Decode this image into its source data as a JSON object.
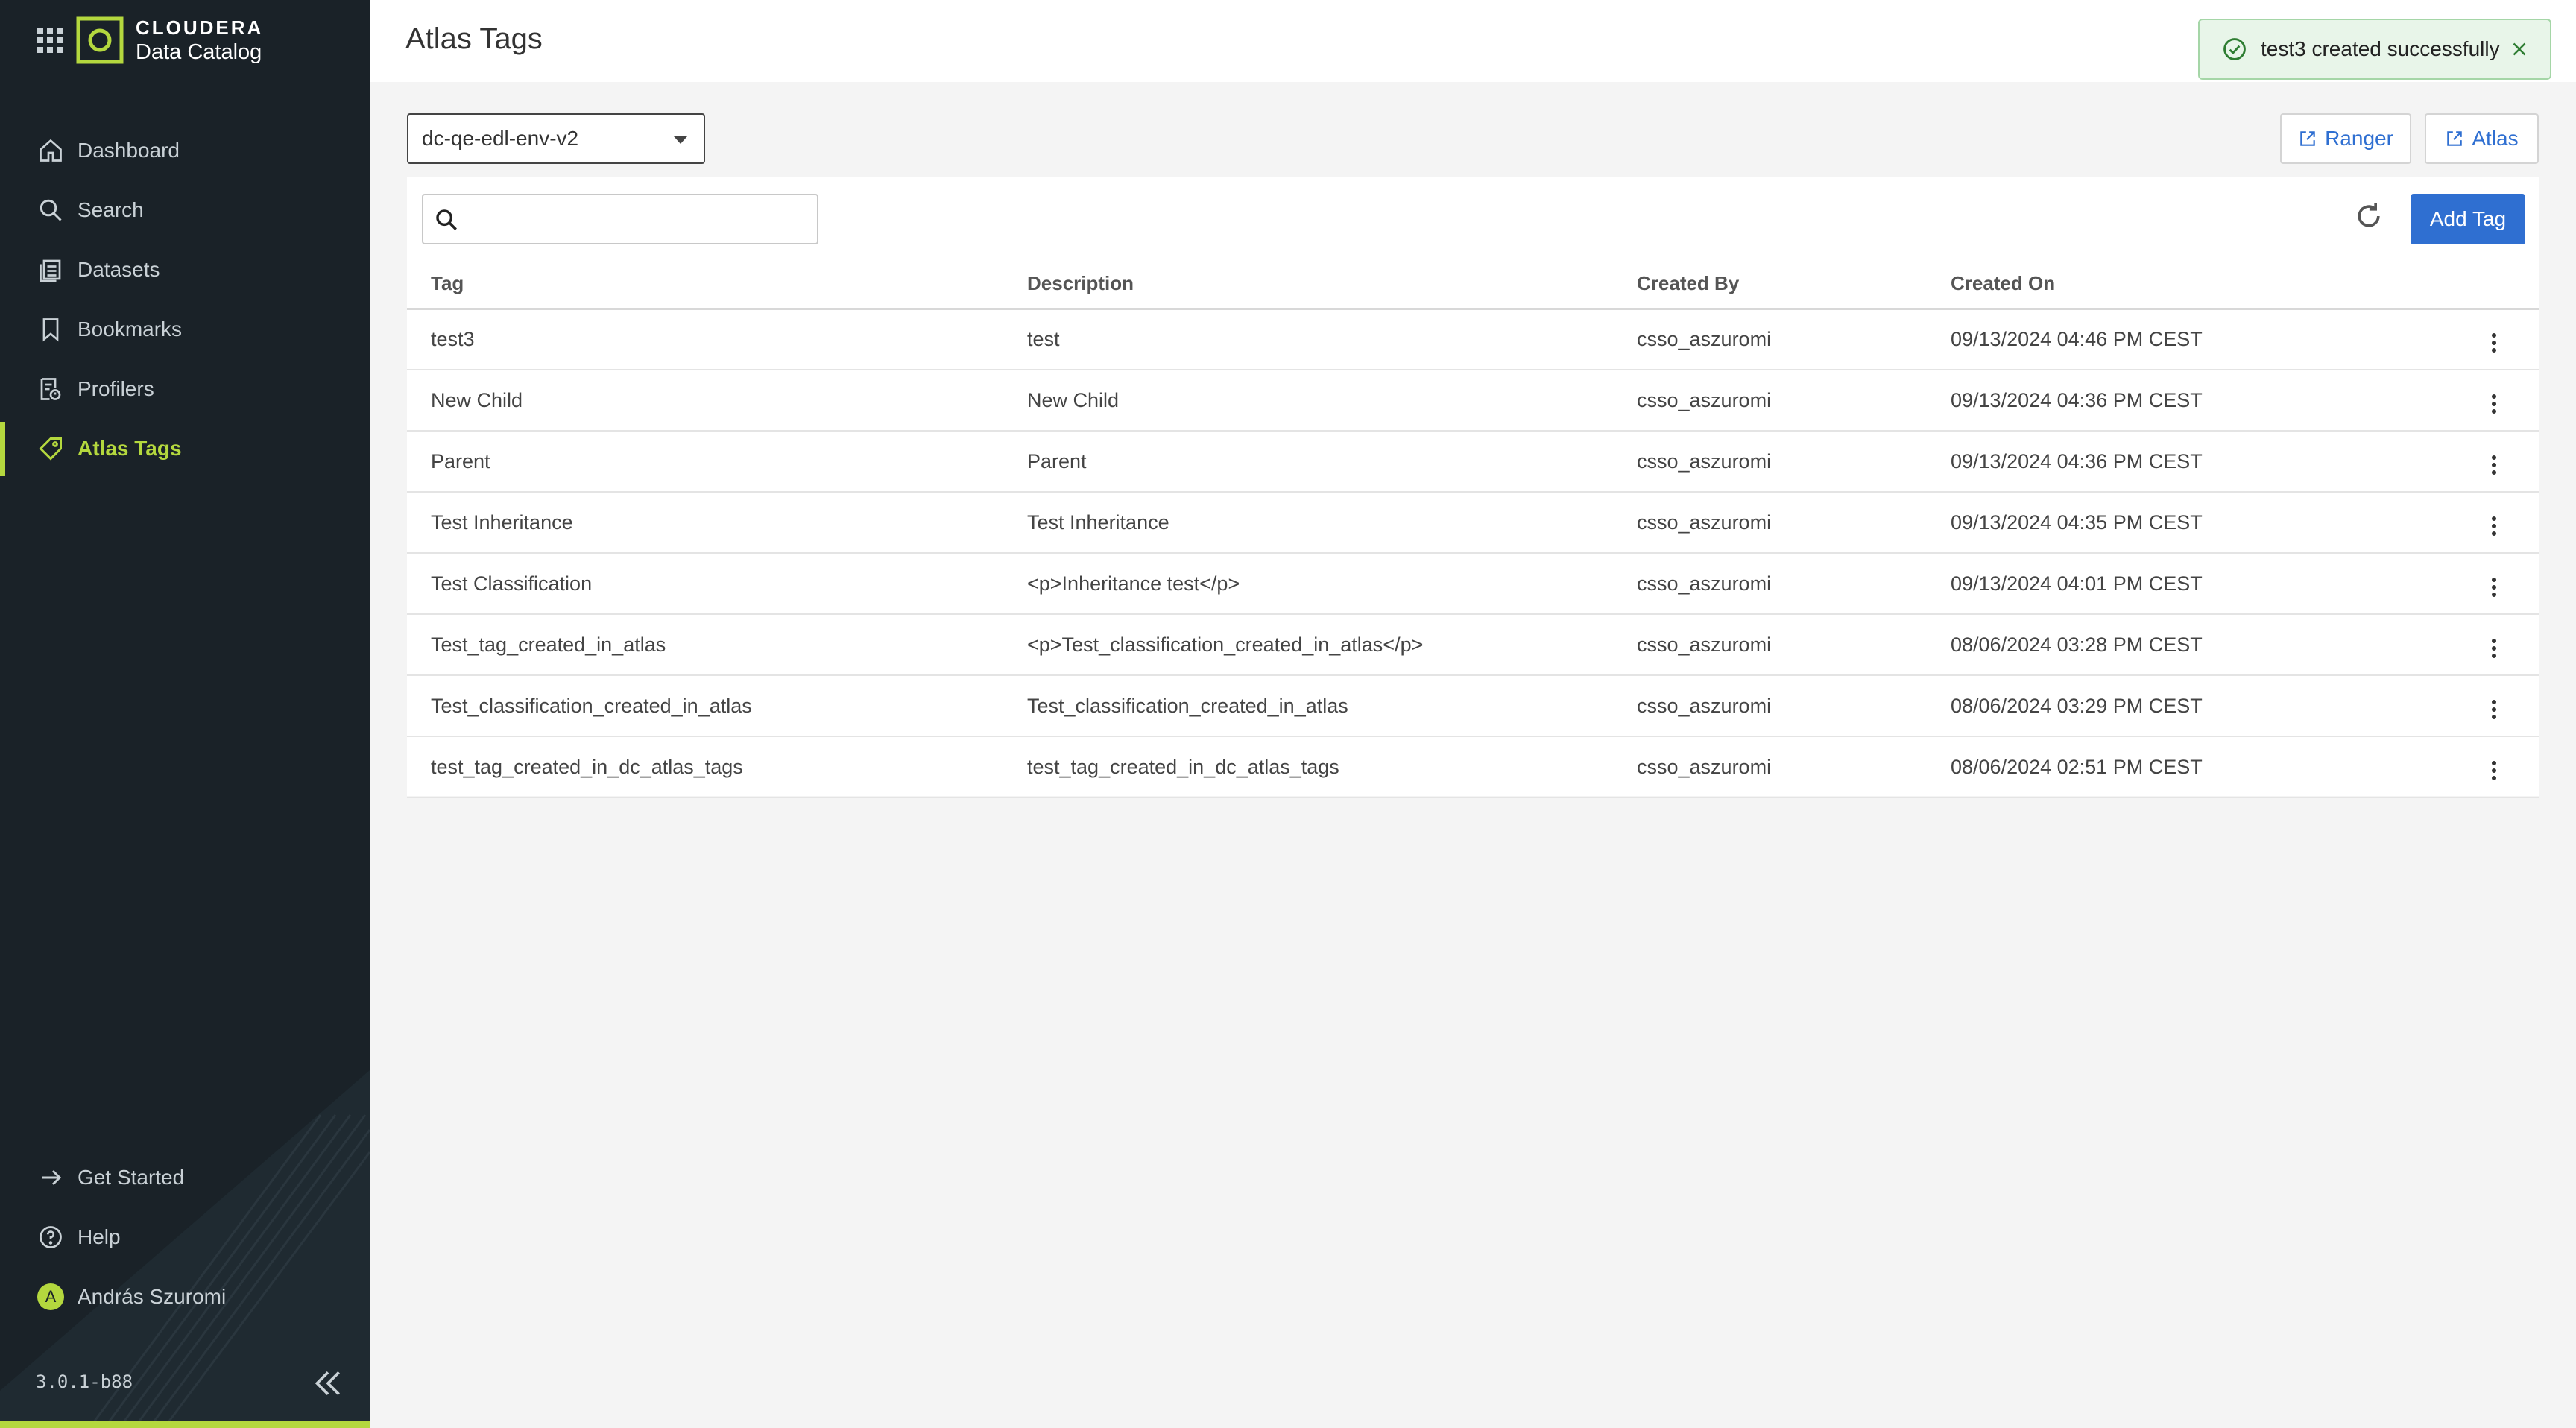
{
  "brand": {
    "line1": "CLOUDERA",
    "line2": "Data Catalog"
  },
  "nav": {
    "items": [
      {
        "label": "Dashboard",
        "icon": "home-icon"
      },
      {
        "label": "Search",
        "icon": "search-icon"
      },
      {
        "label": "Datasets",
        "icon": "datasets-icon"
      },
      {
        "label": "Bookmarks",
        "icon": "bookmark-icon"
      },
      {
        "label": "Profilers",
        "icon": "profiler-icon"
      },
      {
        "label": "Atlas Tags",
        "icon": "tag-icon",
        "active": true
      }
    ],
    "get_started": "Get Started",
    "help": "Help",
    "user": "András Szuromi",
    "user_initial": "A",
    "version": "3.0.1-b88"
  },
  "page": {
    "title": "Atlas Tags"
  },
  "toast": {
    "message": "test3 created successfully"
  },
  "environment": {
    "selected": "dc-qe-edl-env-v2"
  },
  "buttons": {
    "ranger": "Ranger",
    "atlas": "Atlas",
    "add_tag": "Add Tag"
  },
  "search": {
    "value": "",
    "placeholder": ""
  },
  "table": {
    "columns": [
      "Tag",
      "Description",
      "Created By",
      "Created On"
    ],
    "rows": [
      {
        "tag": "test3",
        "description": "test",
        "created_by": "csso_aszuromi",
        "created_on": "09/13/2024 04:46 PM CEST"
      },
      {
        "tag": "New Child",
        "description": "New Child",
        "created_by": "csso_aszuromi",
        "created_on": "09/13/2024 04:36 PM CEST"
      },
      {
        "tag": "Parent",
        "description": "Parent",
        "created_by": "csso_aszuromi",
        "created_on": "09/13/2024 04:36 PM CEST"
      },
      {
        "tag": "Test Inheritance",
        "description": "Test Inheritance",
        "created_by": "csso_aszuromi",
        "created_on": "09/13/2024 04:35 PM CEST"
      },
      {
        "tag": "Test Classification",
        "description": "<p>Inheritance test</p>",
        "created_by": "csso_aszuromi",
        "created_on": "09/13/2024 04:01 PM CEST"
      },
      {
        "tag": "Test_tag_created_in_atlas",
        "description": "<p>Test_classification_created_in_atlas</p>",
        "created_by": "csso_aszuromi",
        "created_on": "08/06/2024 03:28 PM CEST"
      },
      {
        "tag": "Test_classification_created_in_atlas",
        "description": "Test_classification_created_in_atlas",
        "created_by": "csso_aszuromi",
        "created_on": "08/06/2024 03:29 PM CEST"
      },
      {
        "tag": "test_tag_created_in_dc_atlas_tags",
        "description": "test_tag_created_in_dc_atlas_tags",
        "created_by": "csso_aszuromi",
        "created_on": "08/06/2024 02:51 PM CEST"
      }
    ]
  },
  "colors": {
    "sidebar_bg": "#1a2228",
    "accent": "#b4d83e",
    "primary": "#2f6fd1",
    "toast_bg": "#e8f5e9"
  }
}
